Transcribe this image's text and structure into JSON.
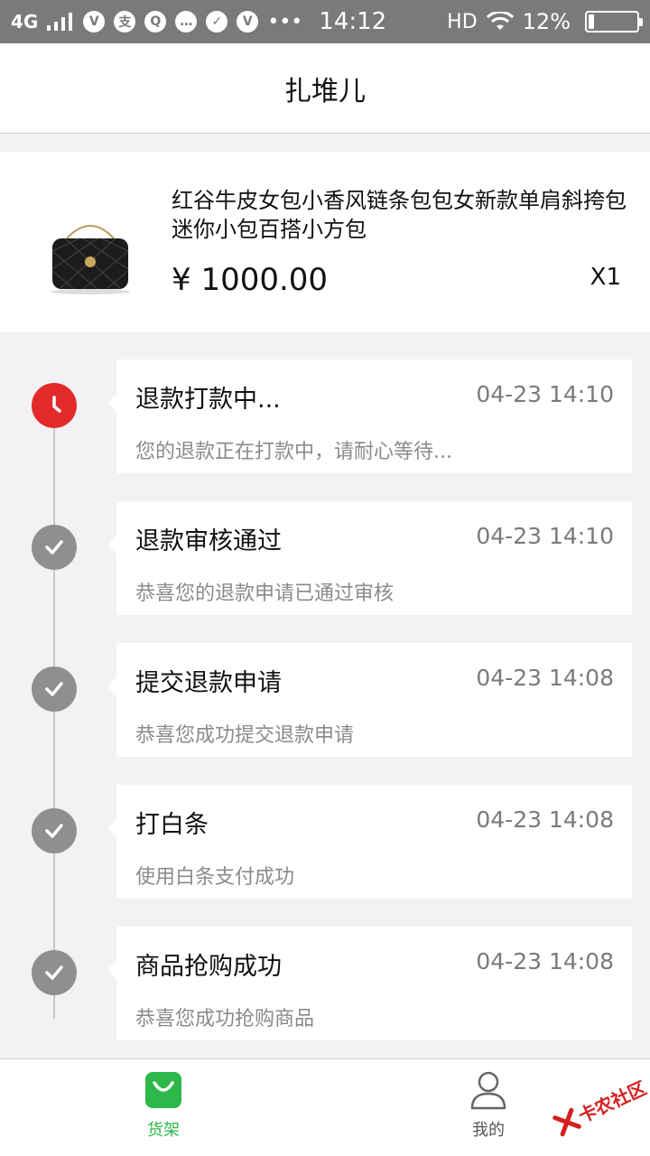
{
  "status_bar": {
    "network": "4G",
    "time": "14:12",
    "hd": "HD",
    "battery": "12%",
    "battery_level": 0.12
  },
  "header": {
    "title": "扎堆儿"
  },
  "product": {
    "title": "红谷牛皮女包小香风链条包包女新款单肩斜挎包迷你小包百搭小方包",
    "price": "¥ 1000.00",
    "quantity": "X1"
  },
  "timeline": [
    {
      "title": "退款打款中...",
      "time": "04-23 14:10",
      "desc": "您的退款正在打款中，请耐心等待...",
      "status": "active"
    },
    {
      "title": "退款审核通过",
      "time": "04-23 14:10",
      "desc": "恭喜您的退款申请已通过审核",
      "status": "done"
    },
    {
      "title": "提交退款申请",
      "time": "04-23 14:08",
      "desc": "恭喜您成功提交退款申请",
      "status": "done"
    },
    {
      "title": "打白条",
      "time": "04-23 14:08",
      "desc": "使用白条支付成功",
      "status": "done"
    },
    {
      "title": "商品抢购成功",
      "time": "04-23 14:08",
      "desc": "恭喜您成功抢购商品",
      "status": "done"
    }
  ],
  "tabs": [
    {
      "label": "货架",
      "icon": "shopping-bag-icon",
      "active": true
    },
    {
      "label": "我的",
      "icon": "person-icon",
      "active": false
    }
  ],
  "watermark": {
    "text": "卡农社区"
  },
  "colors": {
    "accent": "#2db84a",
    "active_dot": "#e32a2a",
    "done_dot": "#8f8f8f"
  }
}
